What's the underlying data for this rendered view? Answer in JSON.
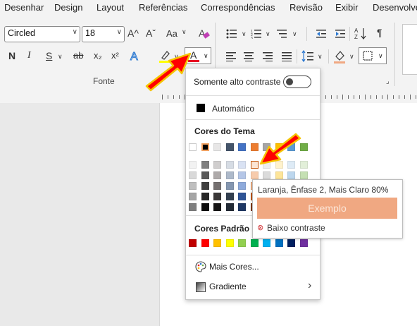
{
  "tabs": [
    "Desenhar",
    "Design",
    "Layout",
    "Referências",
    "Correspondências",
    "Revisão",
    "Exibir",
    "Desenvolve"
  ],
  "ribbon": {
    "font_name": "Circled",
    "font_size": "18",
    "bold": "N",
    "italic": "I",
    "underline": "S",
    "strike": "ab",
    "subscript": "x₂",
    "superscript": "x²",
    "font_color_glyph": "A",
    "grow_font": "A^",
    "shrink_font": "Aˇ",
    "change_case": "Aa",
    "pilcrow": "¶",
    "group_label": "Fonte",
    "launcher": "⌟"
  },
  "dropdown": {
    "high_contrast_label": "Somente alto contraste",
    "automatic_label": "Automático",
    "theme_colors_label": "Cores do Tema",
    "standard_colors_label": "Cores Padrão",
    "more_colors_label": "Mais Cores...",
    "gradient_label": "Gradiente",
    "gradient_chevron": "›",
    "theme_top": [
      "#ffffff",
      "#000000",
      "#e7e6e6",
      "#44546a",
      "#4472c4",
      "#ed7d31",
      "#a5a5a5",
      "#ffc000",
      "#5b9bd5",
      "#70ad47"
    ],
    "theme_shades": [
      [
        "#f2f2f2",
        "#7f7f7f",
        "#d0cece",
        "#d6dce4",
        "#d9e2f3",
        "#fbe5d5",
        "#ededed",
        "#fff2cc",
        "#deebf6",
        "#e2efd9"
      ],
      [
        "#d9d9d9",
        "#595959",
        "#aeaaaa",
        "#adb9ca",
        "#b4c6e7",
        "#f7cbac",
        "#dbdbdb",
        "#fee599",
        "#bdd7ee",
        "#c5e0b3"
      ],
      [
        "#bfbfbf",
        "#3f3f3f",
        "#757070",
        "#8496b0",
        "#8eaadb",
        "#f4b183",
        "#c9c9c9",
        "#ffd965",
        "#9dc3e6",
        "#a8d08d"
      ],
      [
        "#a5a5a5",
        "#262626",
        "#3a3838",
        "#323f4f",
        "#2f5496",
        "#c45911",
        "#7b7b7b",
        "#bf9000",
        "#2e75b5",
        "#538135"
      ],
      [
        "#7f7f7f",
        "#0c0c0c",
        "#171616",
        "#222a35",
        "#1f3864",
        "#833c0b",
        "#525252",
        "#7f6000",
        "#1e4e79",
        "#375623"
      ]
    ],
    "standard": [
      "#c00000",
      "#ff0000",
      "#ffc000",
      "#ffff00",
      "#92d050",
      "#00b050",
      "#00b0f0",
      "#0070c0",
      "#002060",
      "#7030a0"
    ]
  },
  "tooltip": {
    "title": "Laranja, Ênfase 2, Mais Claro 80%",
    "sample": "Exemplo",
    "sample_color": "#f0a882",
    "warning": "Baixo contraste",
    "warning_icon": "⊗"
  },
  "colors": {
    "accent_red": "#e81123",
    "arrow_red": "#ff0000",
    "arrow_outline": "#f5c400"
  }
}
